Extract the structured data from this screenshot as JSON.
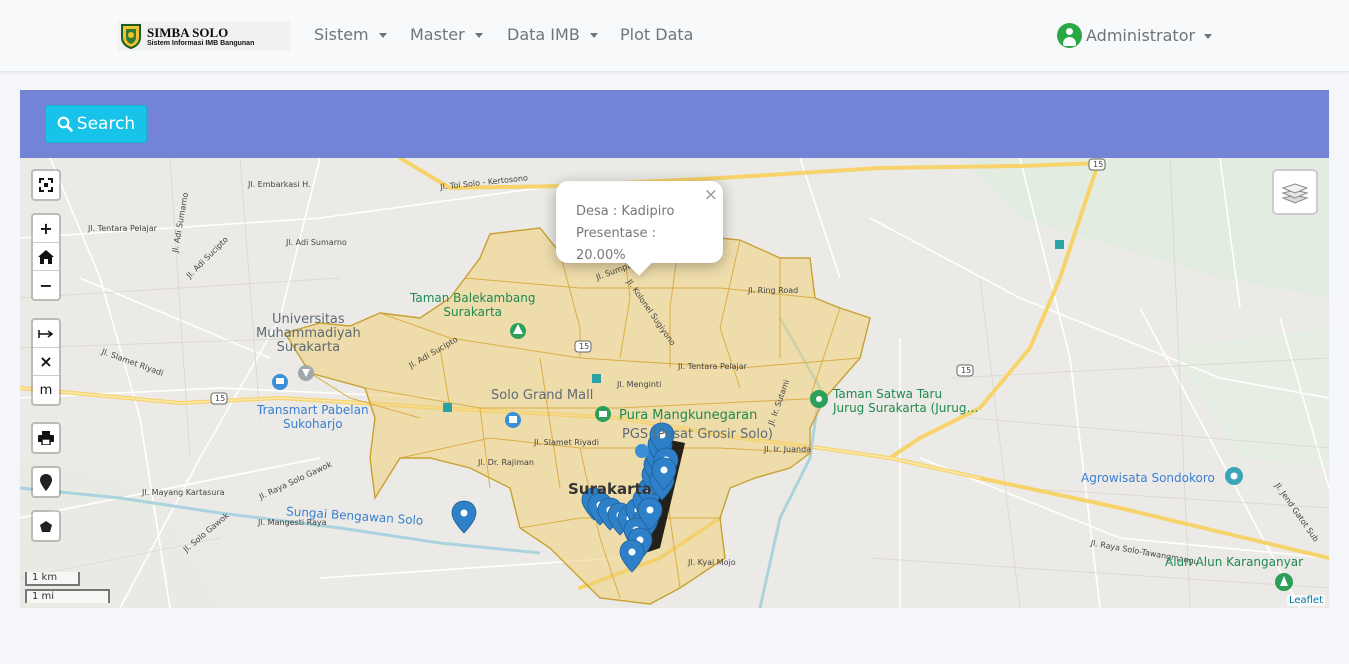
{
  "brand": {
    "title": "SIMBA SOLO",
    "subtitle": "Sistem Informasi IMB Bangunan"
  },
  "nav": {
    "items": [
      {
        "label": "Sistem",
        "dropdown": true
      },
      {
        "label": "Master",
        "dropdown": true
      },
      {
        "label": "Data IMB",
        "dropdown": true
      },
      {
        "label": "Plot Data",
        "dropdown": false
      }
    ],
    "user": {
      "label": "Administrator",
      "dropdown": true
    }
  },
  "search": {
    "button_label": "Search"
  },
  "map": {
    "popup": {
      "line1": "Desa : Kadipiro",
      "line2": "Presentase : 20.00%",
      "close": "×"
    },
    "controls": {
      "zoom_in": "+",
      "zoom_out": "−",
      "measure_clear": "×",
      "measure_unit": "m"
    },
    "places": {
      "taman_balekambang": "Taman Balekambang\nSurakarta",
      "ums": "Universitas\nMuhammadiyah\nSurakarta",
      "transmart": "Transmart Pabelan\nSukoharjo",
      "solo_grand_mall": "Solo Grand Mall",
      "pura_mangkunegaran": "Pura Mangkunegaran",
      "pgs": "PGS (Pusat Grosir Solo)",
      "taman_satwa": "Taman Satwa Taru\nJurug Surakarta (Jurug…",
      "agrowisata": "Agrowisata Sondokoro",
      "sungai": "Sungai Bengawan Solo",
      "alun_alun": "Alun Alun Karanganyar",
      "surakarta": "Surakarta"
    },
    "streets": {
      "tol": "Jl. Tol Solo - Kertosono",
      "embarkasi": "Jl. Embarkasi H.",
      "sumarno": "Jl. Adi Sumarno",
      "pelajar": "Jl. Tentara Pelajar",
      "sucipto": "Jl. Adi Sucipto",
      "ring": "Jl. Ring Road",
      "sumpah": "Jl. Sumpah Pemuda",
      "sugiyono": "Jl. Kolonel Sugiyono",
      "slamet": "Jl. Slamet Riyadi",
      "menginti": "Jl. Menginti",
      "tentara2": "Jl. Tentara Pelajar",
      "rajiman": "Jl. Dr. Rajiman",
      "juanda": "Jl. Ir. Juanda",
      "sutami": "Jl. Ir. Sutami",
      "kyai": "Jl. Kyai Mojo",
      "gawok": "Jl. Raya Solo Gawok",
      "mayang": "Jl. Mayang Kartasura",
      "mangesti": "Jl. Mangesti Raya",
      "solo_gawok": "Jl. Solo Gawok",
      "tawangmangu": "Jl. Raya Solo-Tawangmangu",
      "jendral": "Jl. Jend Gatot Sub"
    },
    "road_numbers": [
      "15",
      "15",
      "15",
      "15"
    ],
    "scale": {
      "km": "1 km",
      "mi": "1 mi"
    },
    "attribution": "Leaflet"
  },
  "colors": {
    "accent": "#7383d6",
    "button": "#17c3e8",
    "polygon": "#e3b84a",
    "marker": "#3387c8"
  }
}
